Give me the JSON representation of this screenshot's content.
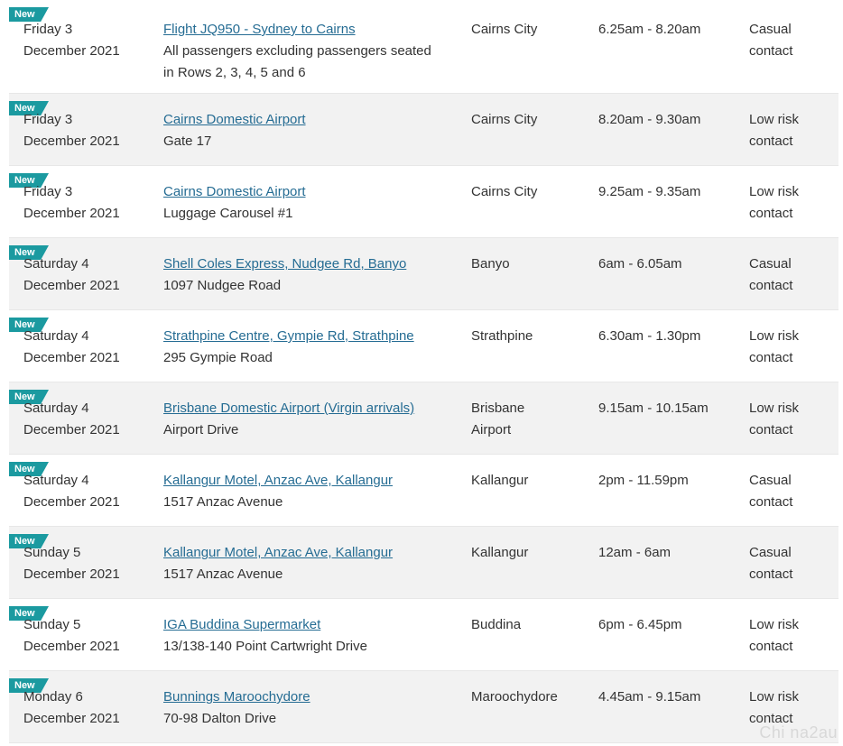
{
  "badge": "New",
  "rows": [
    {
      "day": "Friday 3",
      "date": "December 2021",
      "place": "Flight JQ950 - Sydney to Cairns",
      "address": "All passengers excluding passengers seated in Rows 2, 3, 4, 5 and 6",
      "suburb": "Cairns City",
      "time": "6.25am - 8.20am",
      "risk": "Casual contact"
    },
    {
      "day": "Friday 3",
      "date": "December 2021",
      "place": "Cairns Domestic Airport",
      "address": "Gate 17",
      "suburb": "Cairns City",
      "time": "8.20am - 9.30am",
      "risk": "Low risk contact"
    },
    {
      "day": "Friday 3",
      "date": "December 2021",
      "place": "Cairns Domestic Airport",
      "address": "Luggage Carousel #1",
      "suburb": "Cairns City",
      "time": "9.25am - 9.35am",
      "risk": "Low risk contact"
    },
    {
      "day": "Saturday 4",
      "date": "December 2021",
      "place": "Shell Coles Express, Nudgee Rd, Banyo",
      "address": "1097 Nudgee Road",
      "suburb": "Banyo",
      "time": "6am - 6.05am",
      "risk": "Casual contact"
    },
    {
      "day": "Saturday 4",
      "date": "December 2021",
      "place": "Strathpine Centre, Gympie Rd, Strathpine",
      "address": "295 Gympie Road",
      "suburb": "Strathpine",
      "time": "6.30am - 1.30pm",
      "risk": "Low risk contact"
    },
    {
      "day": "Saturday 4",
      "date": "December 2021",
      "place": "Brisbane Domestic Airport (Virgin arrivals)",
      "address": "Airport Drive",
      "suburb": "Brisbane Airport",
      "time": "9.15am - 10.15am",
      "risk": "Low risk contact"
    },
    {
      "day": "Saturday 4",
      "date": "December 2021",
      "place": "Kallangur Motel, Anzac Ave, Kallangur",
      "address": "1517 Anzac Avenue",
      "suburb": "Kallangur",
      "time": "2pm - 11.59pm",
      "risk": "Casual contact"
    },
    {
      "day": "Sunday 5",
      "date": "December 2021",
      "place": "Kallangur Motel, Anzac Ave, Kallangur",
      "address": "1517 Anzac Avenue",
      "suburb": "Kallangur",
      "time": "12am - 6am",
      "risk": "Casual contact"
    },
    {
      "day": "Sunday 5",
      "date": "December 2021",
      "place": "IGA Buddina Supermarket",
      "address": "13/138-140 Point Cartwright Drive",
      "suburb": "Buddina",
      "time": "6pm - 6.45pm",
      "risk": "Low risk contact"
    },
    {
      "day": "Monday 6",
      "date": "December 2021",
      "place": "Bunnings Maroochydore",
      "address": "70-98 Dalton Drive",
      "suburb": "Maroochydore",
      "time": "4.45am - 9.15am",
      "risk": "Low risk contact"
    }
  ],
  "watermark": "Chi na2au"
}
